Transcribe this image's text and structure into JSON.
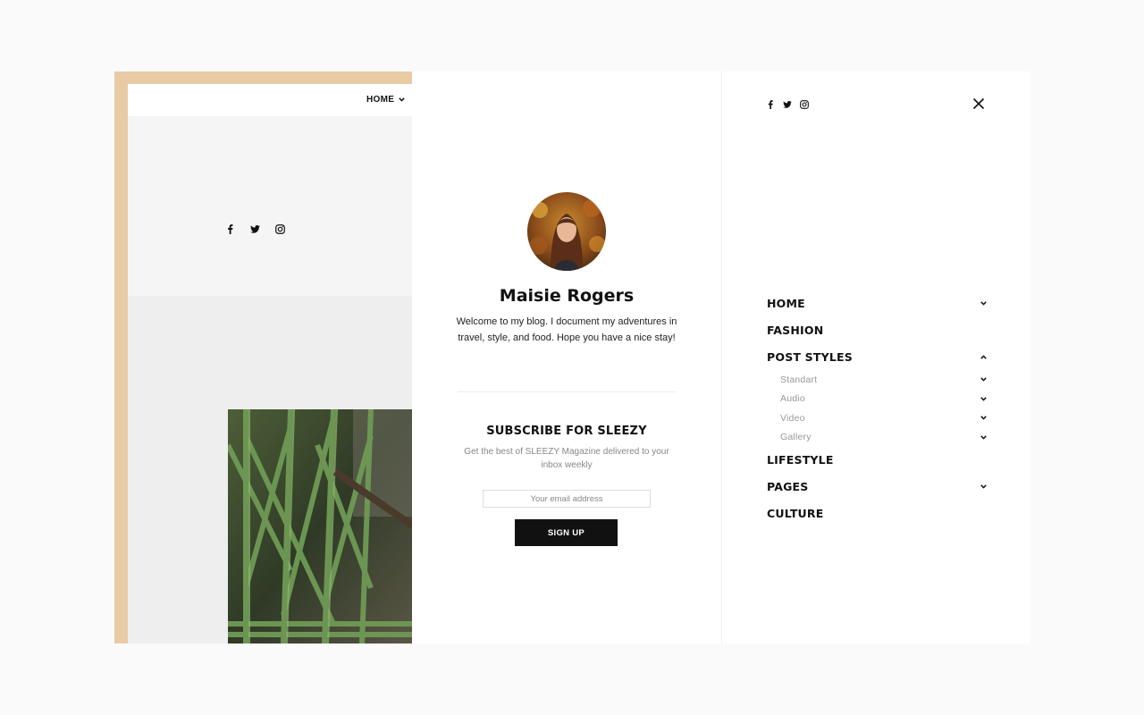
{
  "site": {
    "nav_home_label": "HOME",
    "social_icons": [
      "facebook-icon",
      "twitter-icon",
      "instagram-icon"
    ]
  },
  "about": {
    "author_name": "Maisie Rogers",
    "bio": "Welcome to my blog. I document my adventures in travel, style, and food. Hope you have a nice stay!",
    "subscribe_title": "SUBSCRIBE FOR SLEEZY",
    "subscribe_desc": "Get the best of SLEEZY Magazine delivered to your inbox weekly",
    "email_placeholder": "Your email address",
    "email_value": "",
    "signup_label": "SIGN UP"
  },
  "menu": {
    "social_icons": [
      "facebook-icon",
      "twitter-icon",
      "instagram-icon"
    ],
    "close_icon": "close-icon",
    "items": [
      {
        "label": "HOME",
        "chevron": "down"
      },
      {
        "label": "FASHION",
        "chevron": null
      },
      {
        "label": "POST STYLES",
        "chevron": "up"
      },
      {
        "label": "LIFESTYLE",
        "chevron": null
      },
      {
        "label": "PAGES",
        "chevron": "down"
      },
      {
        "label": "CULTURE",
        "chevron": null
      }
    ],
    "post_styles_sub": [
      {
        "label": "Standart"
      },
      {
        "label": "Audio"
      },
      {
        "label": "Video"
      },
      {
        "label": "Gallery"
      }
    ]
  },
  "colors": {
    "frame_accent": "#e8cba3",
    "button_bg": "#111111",
    "muted_text": "#999999"
  }
}
